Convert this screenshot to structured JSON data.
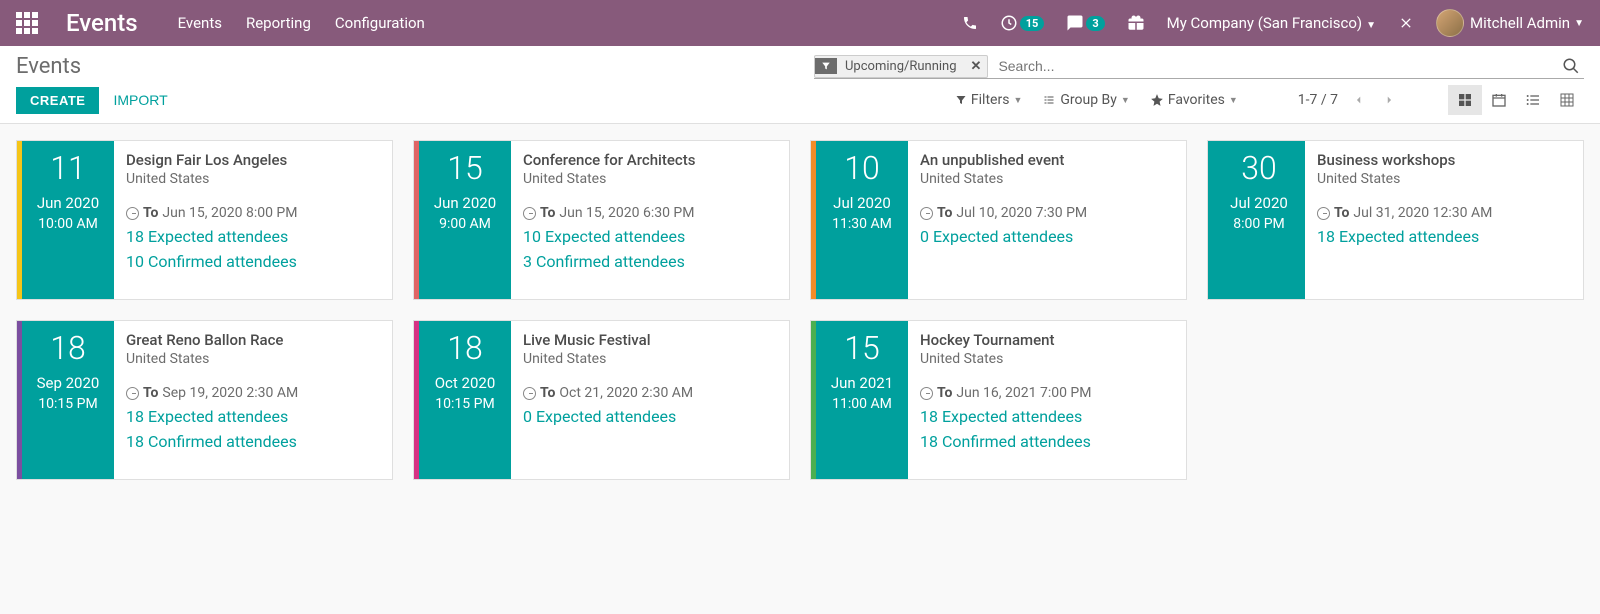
{
  "topbar": {
    "brand": "Events",
    "nav": [
      "Events",
      "Reporting",
      "Configuration"
    ],
    "clock_badge": "15",
    "chat_badge": "3",
    "company": "My Company (San Francisco)",
    "user": "Mitchell Admin"
  },
  "breadcrumb": "Events",
  "buttons": {
    "create": "CREATE",
    "import": "IMPORT"
  },
  "search": {
    "facet": "Upcoming/Running",
    "placeholder": "Search..."
  },
  "toolbar": {
    "filters": "Filters",
    "groupby": "Group By",
    "favorites": "Favorites",
    "pager": "1-7 / 7"
  },
  "labels": {
    "to": "To"
  },
  "events": [
    {
      "edge": "#f5c518",
      "day": "11",
      "month": "Jun 2020",
      "time": "10:00 AM",
      "title": "Design Fair Los Angeles",
      "loc": "United States",
      "to": "Jun 15, 2020 8:00 PM",
      "expected": "18 Expected attendees",
      "confirmed": "10 Confirmed attendees"
    },
    {
      "edge": "#e06666",
      "day": "15",
      "month": "Jun 2020",
      "time": "9:00 AM",
      "title": "Conference for Architects",
      "loc": "United States",
      "to": "Jun 15, 2020 6:30 PM",
      "expected": "10 Expected attendees",
      "confirmed": "3 Confirmed attendees"
    },
    {
      "edge": "#f28c28",
      "day": "10",
      "month": "Jul 2020",
      "time": "11:30 AM",
      "title": "An unpublished event",
      "loc": "United States",
      "to": "Jul 10, 2020 7:30 PM",
      "expected": "0 Expected attendees",
      "confirmed": null
    },
    {
      "edge": "#00a09d",
      "day": "30",
      "month": "Jul 2020",
      "time": "8:00 PM",
      "title": "Business workshops",
      "loc": "United States",
      "to": "Jul 31, 2020 12:30 AM",
      "expected": "18 Expected attendees",
      "confirmed": null
    },
    {
      "edge": "#7b4fa0",
      "day": "18",
      "month": "Sep 2020",
      "time": "10:15 PM",
      "title": "Great Reno Ballon Race",
      "loc": "United States",
      "to": "Sep 19, 2020 2:30 AM",
      "expected": "18 Expected attendees",
      "confirmed": "18 Confirmed attendees"
    },
    {
      "edge": "#d63384",
      "day": "18",
      "month": "Oct 2020",
      "time": "10:15 PM",
      "title": "Live Music Festival",
      "loc": "United States",
      "to": "Oct 21, 2020 2:30 AM",
      "expected": "0 Expected attendees",
      "confirmed": null
    },
    {
      "edge": "#4caf50",
      "day": "15",
      "month": "Jun 2021",
      "time": "11:00 AM",
      "title": "Hockey Tournament",
      "loc": "United States",
      "to": "Jun 16, 2021 7:00 PM",
      "expected": "18 Expected attendees",
      "confirmed": "18 Confirmed attendees"
    }
  ]
}
